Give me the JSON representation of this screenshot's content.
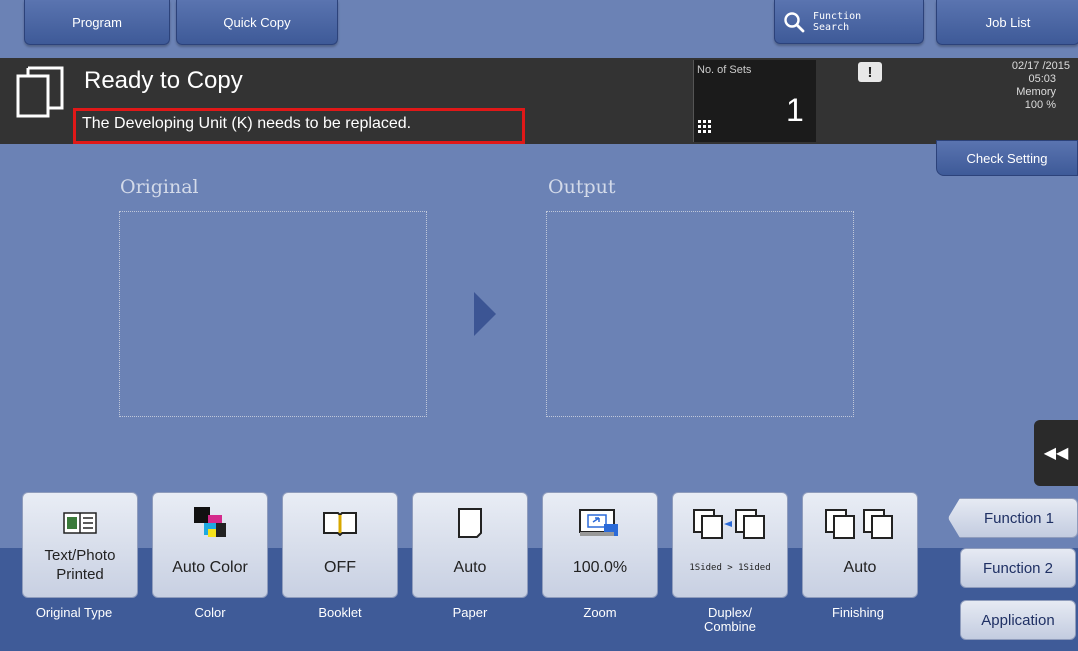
{
  "top_tabs": {
    "program": "Program",
    "quick_copy": "Quick Copy",
    "function_search": "Function Search",
    "job_list": "Job List"
  },
  "status": {
    "title": "Ready to Copy",
    "message": "The Developing Unit (K) needs to be replaced.",
    "sets_label": "No. of Sets",
    "sets_value": "1",
    "date": "02/17 /2015",
    "time": "05:03",
    "memory_label": "Memory",
    "memory_value": "100 %",
    "check_setting": "Check Setting"
  },
  "preview": {
    "original_label": "Original",
    "output_label": "Output"
  },
  "functions": [
    {
      "value": "Text/Photo\nPrinted",
      "label": "Original Type"
    },
    {
      "value": "Auto Color",
      "label": "Color"
    },
    {
      "value": "OFF",
      "label": "Booklet"
    },
    {
      "value": "Auto",
      "label": "Paper"
    },
    {
      "value": "100.0%",
      "label": "Zoom"
    },
    {
      "value": "1Sided > 1Sided",
      "label": "Duplex/\nCombine"
    },
    {
      "value": "Auto",
      "label": "Finishing"
    }
  ],
  "side_buttons": {
    "function1": "Function 1",
    "function2": "Function 2",
    "application": "Application"
  },
  "colors": {
    "bg": "#6b82b5",
    "status_bar": "#333333",
    "highlight": "#e01818",
    "bottom_bar": "#3f5b98"
  }
}
